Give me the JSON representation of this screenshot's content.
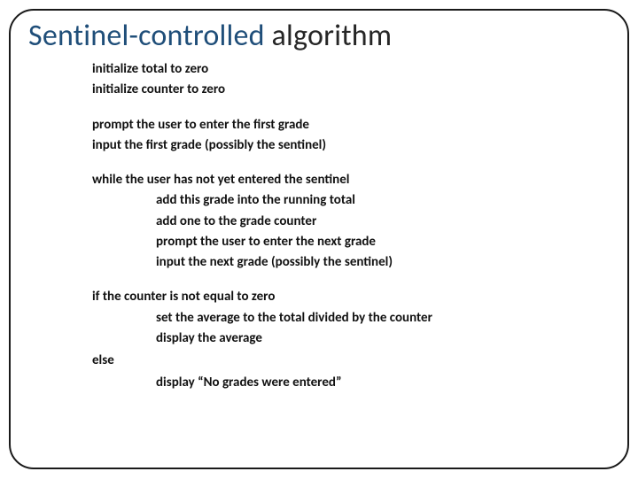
{
  "title": {
    "part1": "Sentinel-controlled ",
    "part2": "algorithm"
  },
  "blocks": {
    "b1": {
      "l1": "initialize total to zero",
      "l2": "initialize counter to zero"
    },
    "b2": {
      "l1": "prompt the user to enter the first grade",
      "l2": "input the first grade (possibly the sentinel)"
    },
    "b3": {
      "l1": "while the user has not yet entered the sentinel",
      "l2": "add this grade into the running total",
      "l3": "add one to the grade counter",
      "l4": "prompt the user to enter the next grade",
      "l5": "input the next grade (possibly the sentinel)"
    },
    "b4": {
      "l1": "if the counter is not equal to zero",
      "l2": "set the average to the total divided by the counter",
      "l3": "display the average",
      "l4": "else",
      "l5": "display “No grades were entered”"
    }
  }
}
